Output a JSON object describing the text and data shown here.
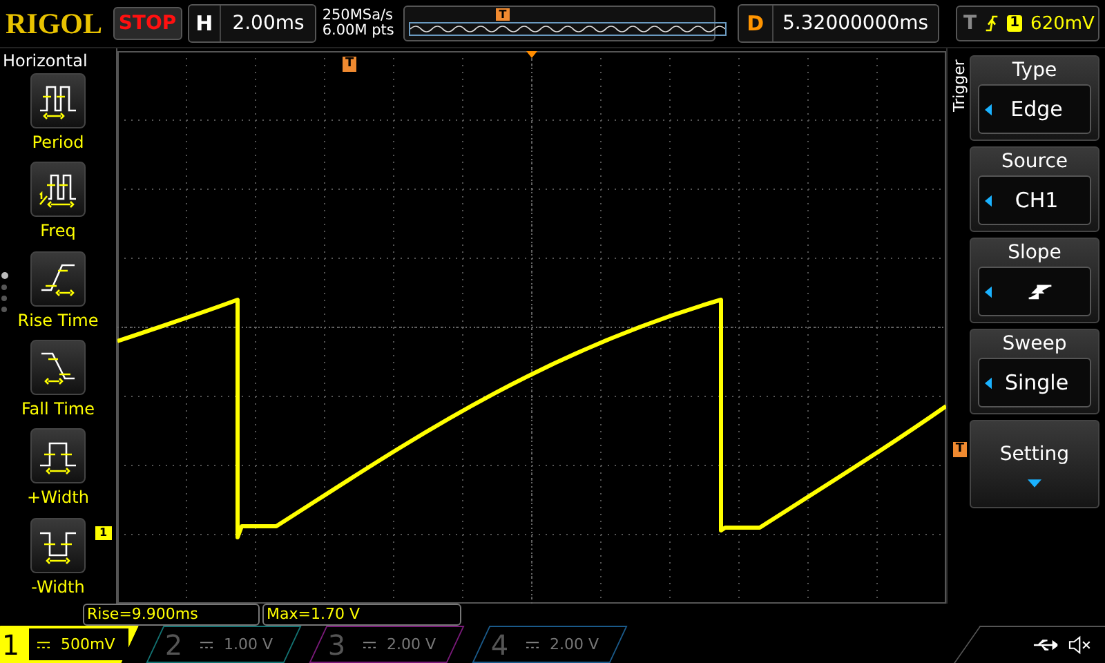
{
  "top_bar": {
    "logo": "RIGOL",
    "run_state": "STOP",
    "horizontal": {
      "label": "H",
      "value": "2.00ms"
    },
    "sample_rate": "250MSa/s",
    "memory_depth": "6.00M pts",
    "memory_marker": "T",
    "delay": {
      "label": "D",
      "value": "5.32000000ms"
    },
    "trigger": {
      "label": "T",
      "channel": "1",
      "level": "620mV"
    }
  },
  "left_menu": {
    "title": "Horizontal",
    "items": [
      {
        "kind": "period",
        "label": "Period"
      },
      {
        "kind": "freq",
        "label": "Freq"
      },
      {
        "kind": "rise",
        "label": "Rise Time"
      },
      {
        "kind": "fall",
        "label": "Fall Time"
      },
      {
        "kind": "pwidth",
        "label": "+Width"
      },
      {
        "kind": "nwidth",
        "label": "-Width"
      }
    ],
    "page_dots": [
      {
        "selected": true
      },
      {
        "selected": false
      },
      {
        "selected": false
      },
      {
        "selected": false
      }
    ]
  },
  "screen": {
    "trigger_position_marker": "T",
    "trigger_level_marker": "T",
    "channel_marker": "1"
  },
  "right_menu": {
    "title": "Trigger",
    "items": [
      {
        "kind": "value",
        "title": "Type",
        "value": "Edge"
      },
      {
        "kind": "value",
        "title": "Source",
        "value": "CH1"
      },
      {
        "kind": "slope",
        "title": "Slope"
      },
      {
        "kind": "value",
        "title": "Sweep",
        "value": "Single"
      },
      {
        "kind": "more",
        "title": "Setting"
      }
    ]
  },
  "measurements": [
    "Rise=9.900ms",
    "Max=1.70 V"
  ],
  "channels": [
    {
      "number": "1",
      "scale": "500mV",
      "color": "#ffff00",
      "selected": true
    },
    {
      "number": "2",
      "scale": "1.00 V",
      "color": "#137373",
      "selected": false
    },
    {
      "number": "3",
      "scale": "2.00 V",
      "color": "#7a1a7a",
      "selected": false
    },
    {
      "number": "4",
      "scale": "2.00 V",
      "color": "#1a5a8a",
      "selected": false
    }
  ]
}
